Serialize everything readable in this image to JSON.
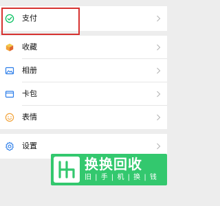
{
  "menu": {
    "pay": {
      "label": "支付",
      "icon": "pay-icon"
    },
    "favorites": {
      "label": "收藏",
      "icon": "favorites-cube-icon"
    },
    "album": {
      "label": "相册",
      "icon": "photo-album-icon"
    },
    "cards": {
      "label": "卡包",
      "icon": "card-wallet-icon"
    },
    "stickers": {
      "label": "表情",
      "icon": "smiley-icon"
    },
    "settings": {
      "label": "设置",
      "icon": "gear-icon"
    }
  },
  "banner": {
    "title": "换换回收",
    "subtitle": "旧 | 手 | 机 | 换 | 钱"
  },
  "colors": {
    "highlight": "#d6312f",
    "banner": "#33c86e",
    "icon_green": "#07c160",
    "icon_blue": "#2b7de9",
    "icon_orange": "#f2a33a"
  }
}
